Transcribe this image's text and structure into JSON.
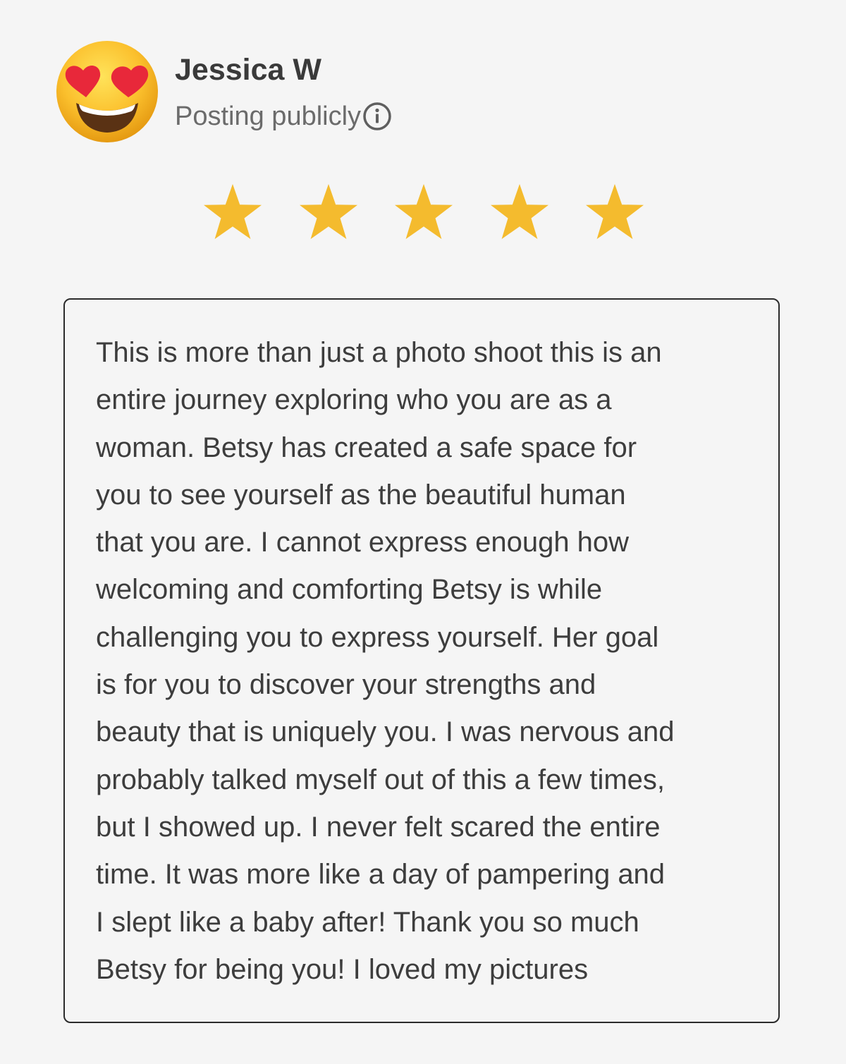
{
  "reviewer": {
    "name": "Jessica W",
    "posting_status": "Posting publicly",
    "avatar_icon": "heart-eyes-emoji-icon",
    "info_icon": "info-icon"
  },
  "rating": {
    "value": 5,
    "max": 5,
    "star_color": "#f4bb2e"
  },
  "review": {
    "lines": [
      "This is more than just a photo shoot this is an",
      "entire journey exploring who you are as a",
      "woman. Betsy has created a safe space for",
      "you to see yourself as the beautiful human",
      "that you are. I cannot express enough how",
      "welcoming and comforting Betsy is while",
      "challenging you to express yourself. Her goal",
      "is for you to discover your strengths and",
      "beauty that is uniquely you. I was nervous and",
      "probably talked myself out of this a few times,",
      "but I showed up. I never felt scared the entire",
      "time. It was more like a day of pampering and",
      "I slept like a baby after!  Thank you so much",
      "Betsy for being you!  I loved my pictures"
    ]
  }
}
